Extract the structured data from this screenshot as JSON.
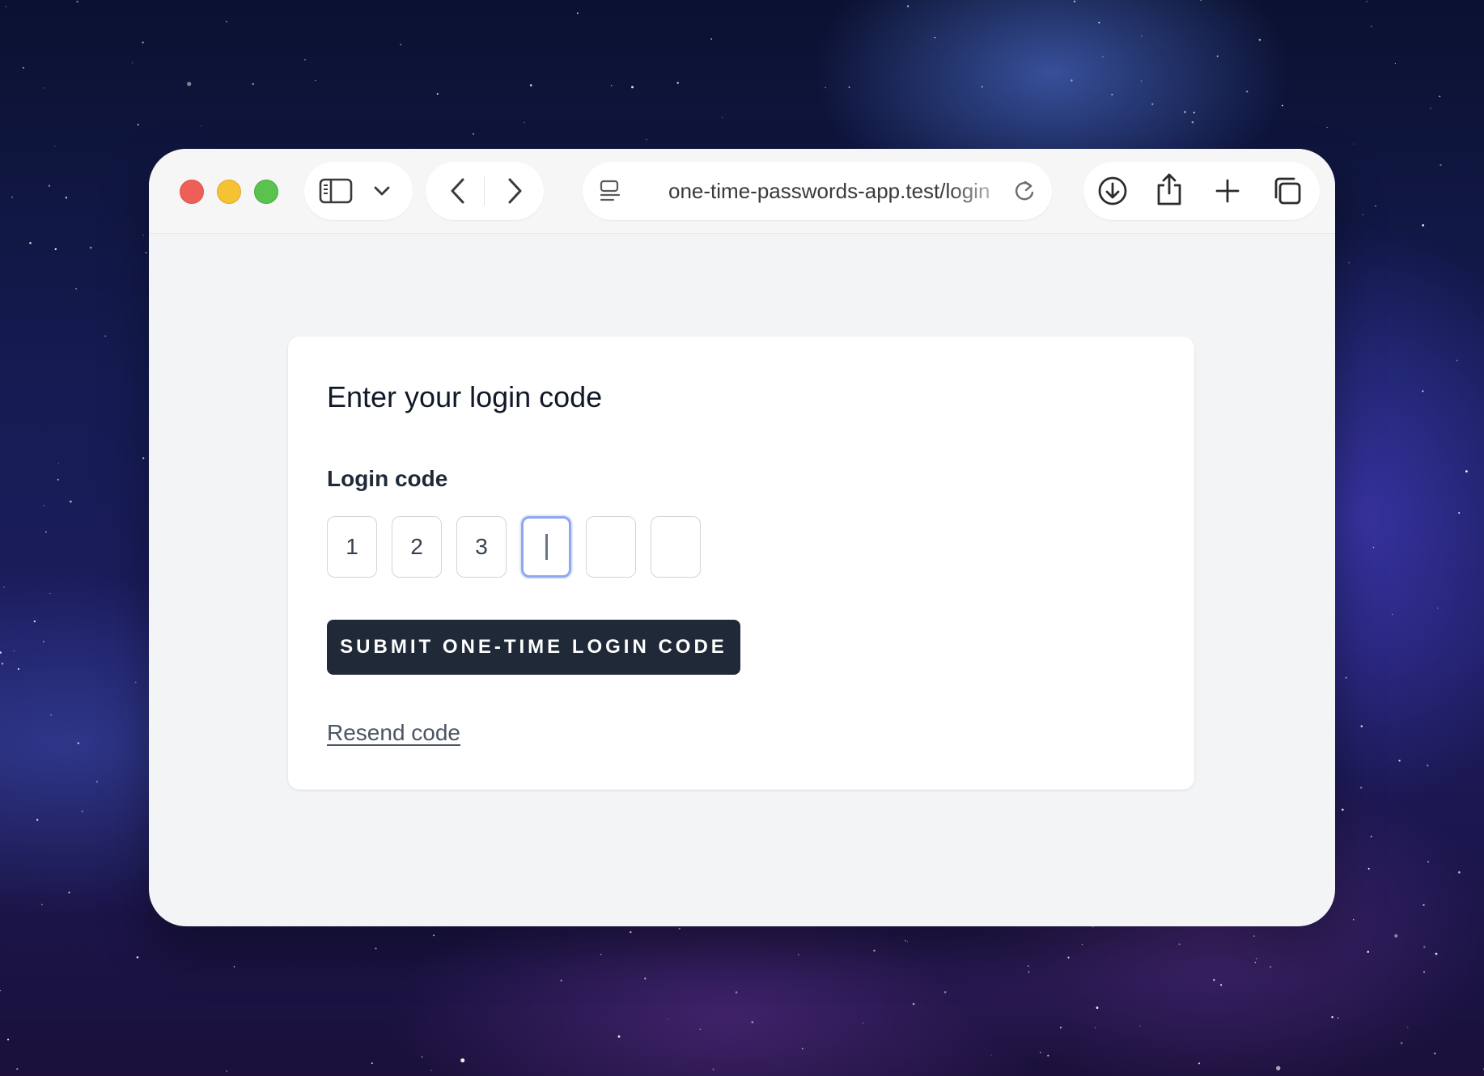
{
  "browser": {
    "url": "one-time-passwords-app.test/login",
    "traffic_lights": [
      "close",
      "minimize",
      "zoom"
    ],
    "icons": {
      "sidebar": "sidebar-icon",
      "chevron": "chevron-down-icon",
      "back": "back-arrow-icon",
      "forward": "forward-arrow-icon",
      "page": "page-menu-icon",
      "reload": "reload-icon",
      "download": "download-icon",
      "share": "share-icon",
      "new_tab": "plus-icon",
      "tabs": "tab-overview-icon"
    }
  },
  "page": {
    "title": "Enter your login code",
    "field_label": "Login code",
    "otp_digits": [
      "1",
      "2",
      "3",
      "",
      "",
      ""
    ],
    "active_index": 3,
    "submit_label": "SUBMIT ONE-TIME LOGIN CODE",
    "resend_label": "Resend code"
  },
  "colors": {
    "button_bg": "#1f2937",
    "focus_ring": "#8ea8f0",
    "page_bg": "#f3f4f6"
  }
}
